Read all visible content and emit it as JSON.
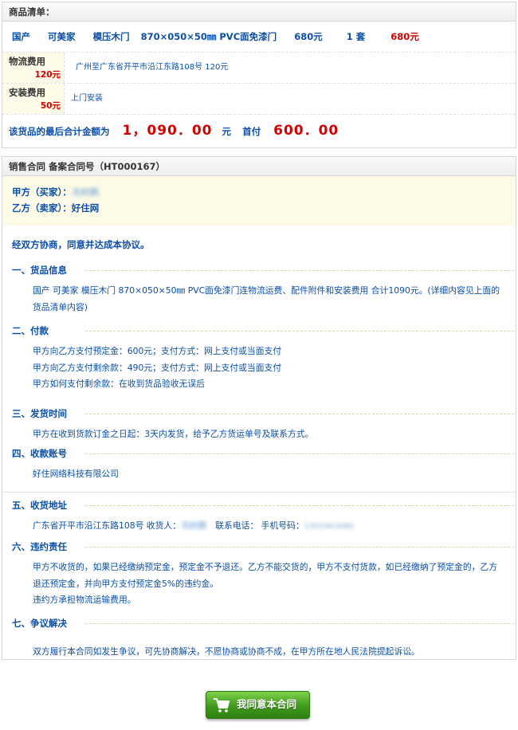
{
  "order": {
    "header": "商品清单：",
    "product": {
      "origin": "国产",
      "brand": "可美家",
      "name": "模压木门",
      "spec": "870×050×50㎜ PVC面免漆门",
      "price": "680元",
      "qty": "1 套",
      "subtotal": "680元"
    },
    "fees": [
      {
        "label": "物流费用",
        "amount": "120元",
        "desc": "广州至广东省开平市沿江东路108号   120元"
      },
      {
        "label": "安装费用",
        "amount": "50元",
        "desc": "上门安装"
      }
    ],
    "total": {
      "label": "该货品的最后合计金额为",
      "amount": "1，090．00",
      "unit": "元",
      "deposit_label": "首付",
      "deposit": "600．00"
    }
  },
  "contract": {
    "header": "销售合同  备案合同号（HT000167）",
    "party_a_label": "甲方（买家）：",
    "party_a_name": "冼树鹏",
    "party_b_label": "乙方（卖家）：",
    "party_b_name": "好住网",
    "intro": "经双方协商，同意并达成本协议。",
    "sections": [
      {
        "title": "一、货品信息",
        "lines": [
          "国产  可美家  模压木门  870×050×50㎜ PVC面免漆门连物流运费、配件附件和安装费用  合计1090元。(详细内容见上面的",
          "货品清单内容)"
        ]
      },
      {
        "title": "二、付款",
        "lines": [
          "甲方向乙方支付预定金：600元；支付方式：网上支付或当面支付",
          "甲方向乙方支付剩余款：490元；支付方式：网上支付或当面支付",
          "甲方如何支付剩余款：在收到货品验收无误后"
        ]
      },
      {
        "title": "三、发货时间",
        "lines": [
          "甲方在收到货款订金之日起：3天内发货，给予乙方货运单号及联系方式。"
        ]
      },
      {
        "title": "四、收款账号",
        "lines": [
          "好住网络科技有限公司"
        ]
      },
      {
        "title": "五、收货地址",
        "address": "广东省开平市沿江东路108号  收货人：",
        "receiver": "冼树鹏",
        "phone_label": "联系电话：   手机号码：",
        "phone": "13533414081"
      },
      {
        "title": "六、违约责任",
        "lines": [
          "甲方不收货的，如果已经缴纳预定金，预定金不予退还。乙方不能交货的，甲方不支付货款，如已经缴纳了预定金的，乙方",
          "退还预定金，并向甲方支付预定金5%的违约金。",
          "违约方承担物流运输费用。"
        ]
      },
      {
        "title": "七、争议解决",
        "lines": [
          "双方履行本合同如发生争议，可先协商解决，不愿协商或协商不成，在甲方所在地人民法院提起诉讼。"
        ]
      }
    ]
  },
  "agree_button": {
    "label": "我同意本合同",
    "icon": "cart-icon"
  },
  "colors": {
    "link_blue": "#0b4fa8",
    "price_red": "#d40000",
    "note_bg": "#fdfbe8",
    "button_green": "#3f9a1c"
  }
}
